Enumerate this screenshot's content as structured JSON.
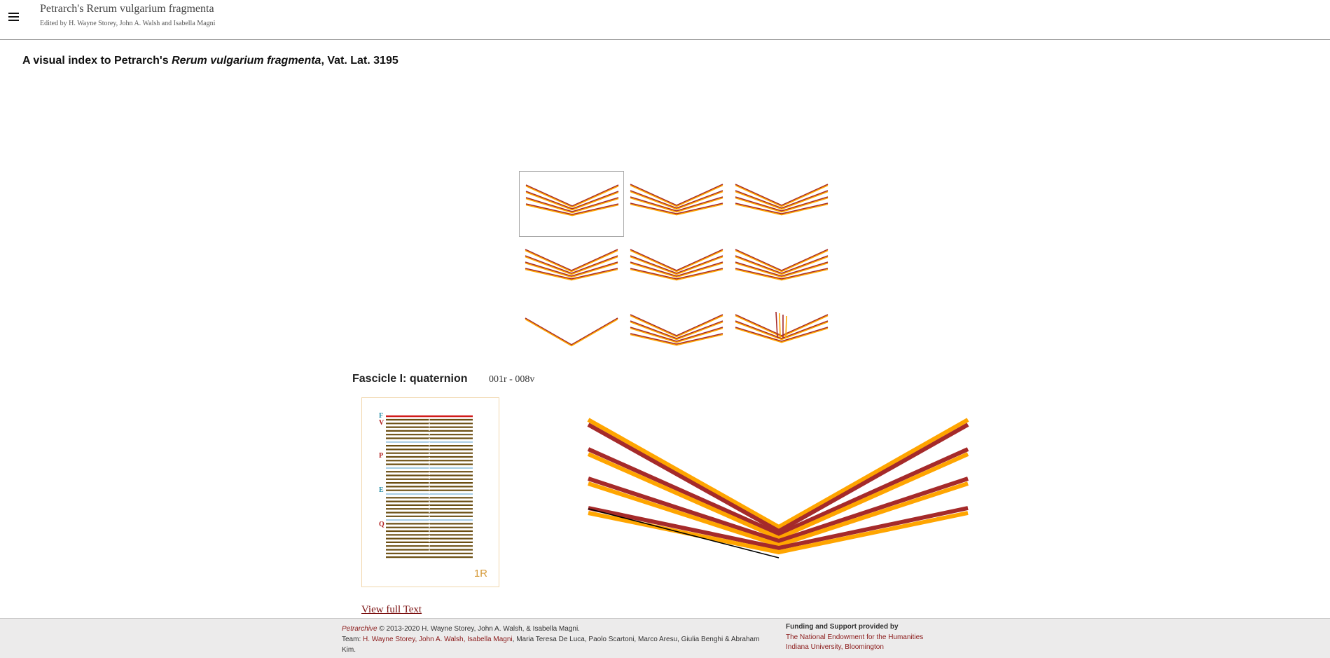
{
  "header": {
    "title": "Petrarch's Rerum vulgarium fragmenta",
    "subtitle": "Edited by H. Wayne Storey, John A. Walsh and Isabella Magni",
    "menu_icon": "hamburger-menu-icon"
  },
  "page": {
    "title_prefix": "A visual index to Petrarch's ",
    "title_italic": "Rerum vulgarium fragmenta",
    "title_suffix": ", Vat. Lat. 3195"
  },
  "fascicles": [
    {
      "id": "I",
      "structure": "quaternion",
      "leaves": 4,
      "selected": true,
      "extra_inserts": 0
    },
    {
      "id": "II",
      "structure": "quaternion",
      "leaves": 4,
      "selected": false,
      "extra_inserts": 0
    },
    {
      "id": "III",
      "structure": "quaternion",
      "leaves": 4,
      "selected": false,
      "extra_inserts": 0
    },
    {
      "id": "IV",
      "structure": "quaternion",
      "leaves": 4,
      "selected": false,
      "extra_inserts": 0
    },
    {
      "id": "V",
      "structure": "quaternion",
      "leaves": 4,
      "selected": false,
      "extra_inserts": 0
    },
    {
      "id": "VI",
      "structure": "quaternion",
      "leaves": 4,
      "selected": false,
      "extra_inserts": 0
    },
    {
      "id": "VII",
      "structure": "bifolium",
      "leaves": 1,
      "selected": false,
      "extra_inserts": 0
    },
    {
      "id": "VIII",
      "structure": "quaternion",
      "leaves": 4,
      "selected": false,
      "extra_inserts": 0
    },
    {
      "id": "IX",
      "structure": "ternion with inserts",
      "leaves": 3,
      "selected": false,
      "extra_inserts": 4
    }
  ],
  "detail": {
    "fascicle_title": "Fascicle I: quaternion",
    "range": "001r - 008v",
    "page_label": "1R",
    "markers": [
      {
        "letter": "F",
        "color": "#2a8fa8"
      },
      {
        "letter": "V",
        "color": "#b22222"
      },
      {
        "letter": "P",
        "color": "#b22222"
      },
      {
        "letter": "E",
        "color": "#2a8fa8"
      },
      {
        "letter": "Q",
        "color": "#b22222"
      }
    ],
    "view_full_text": "View full Text"
  },
  "colors": {
    "leaf_red": "#a52a2a",
    "leaf_orange": "#ffa500",
    "text_lines": "#6b4e12",
    "link": "#8b1a1a"
  },
  "footer": {
    "project": "Petrarchive",
    "copyright": " © 2013-2020 H. Wayne Storey, John A. Walsh, & Isabella Magni.",
    "team_label": "Team: ",
    "team_links": "H. Wayne Storey, John A. Walsh, Isabella Magni",
    "team_rest": ", Maria Teresa De Luca, Paolo Scartoni, Marco Aresu, Giulia Benghi & Abraham Kim.",
    "funding_title": "Funding and Support provided by",
    "funder_1": "The National Endowment for the Humanities",
    "funder_2": "Indiana University, Bloomington"
  }
}
